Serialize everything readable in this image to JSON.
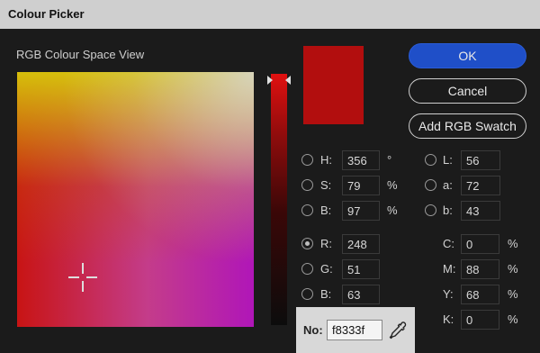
{
  "window": {
    "title": "Colour Picker"
  },
  "view_label": "RGB Colour Space View",
  "colors": {
    "new_swatch": "#b20e0e",
    "ok_button": "#1f4fc8"
  },
  "buttons": {
    "ok": "OK",
    "cancel": "Cancel",
    "add_swatch": "Add RGB Swatch"
  },
  "hsb": [
    {
      "label": "H:",
      "value": "356",
      "unit": "°"
    },
    {
      "label": "S:",
      "value": "79",
      "unit": "%"
    },
    {
      "label": "B:",
      "value": "97",
      "unit": "%"
    }
  ],
  "rgb": [
    {
      "label": "R:",
      "value": "248",
      "checked": true
    },
    {
      "label": "G:",
      "value": "51"
    },
    {
      "label": "B:",
      "value": "63"
    }
  ],
  "lab": [
    {
      "label": "L:",
      "value": "56"
    },
    {
      "label": "a:",
      "value": "72"
    },
    {
      "label": "b:",
      "value": "43"
    }
  ],
  "cmyk": [
    {
      "label": "C:",
      "value": "0",
      "unit": "%"
    },
    {
      "label": "M:",
      "value": "88",
      "unit": "%"
    },
    {
      "label": "Y:",
      "value": "68",
      "unit": "%"
    },
    {
      "label": "K:",
      "value": "0",
      "unit": "%"
    }
  ],
  "hex": {
    "label": "No:",
    "value": "f8333f"
  },
  "icons": {
    "eyedropper": "eyedropper-icon",
    "crosshair": "crosshair-icon",
    "hue_slider": "hue-slider-arrows-icon"
  }
}
